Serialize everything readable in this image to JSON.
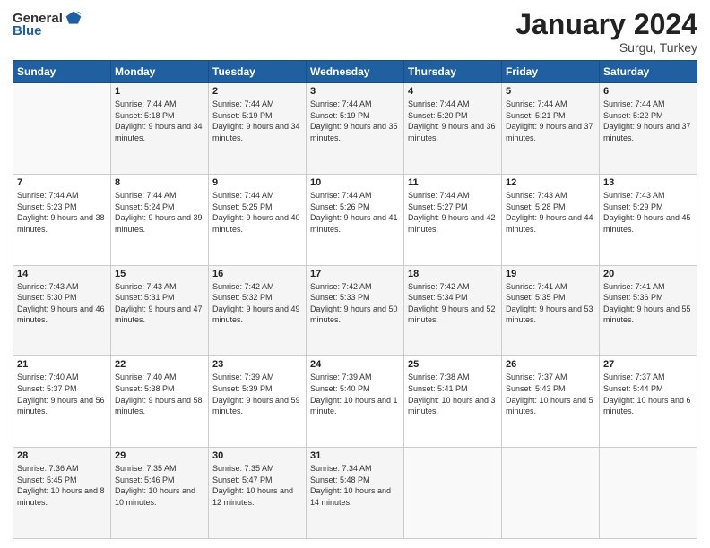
{
  "logo": {
    "general": "General",
    "blue": "Blue"
  },
  "title": "January 2024",
  "location": "Surgu, Turkey",
  "days_header": [
    "Sunday",
    "Monday",
    "Tuesday",
    "Wednesday",
    "Thursday",
    "Friday",
    "Saturday"
  ],
  "weeks": [
    [
      {
        "day": "",
        "sunrise": "",
        "sunset": "",
        "daylight": ""
      },
      {
        "day": "1",
        "sunrise": "Sunrise: 7:44 AM",
        "sunset": "Sunset: 5:18 PM",
        "daylight": "Daylight: 9 hours and 34 minutes."
      },
      {
        "day": "2",
        "sunrise": "Sunrise: 7:44 AM",
        "sunset": "Sunset: 5:19 PM",
        "daylight": "Daylight: 9 hours and 34 minutes."
      },
      {
        "day": "3",
        "sunrise": "Sunrise: 7:44 AM",
        "sunset": "Sunset: 5:19 PM",
        "daylight": "Daylight: 9 hours and 35 minutes."
      },
      {
        "day": "4",
        "sunrise": "Sunrise: 7:44 AM",
        "sunset": "Sunset: 5:20 PM",
        "daylight": "Daylight: 9 hours and 36 minutes."
      },
      {
        "day": "5",
        "sunrise": "Sunrise: 7:44 AM",
        "sunset": "Sunset: 5:21 PM",
        "daylight": "Daylight: 9 hours and 37 minutes."
      },
      {
        "day": "6",
        "sunrise": "Sunrise: 7:44 AM",
        "sunset": "Sunset: 5:22 PM",
        "daylight": "Daylight: 9 hours and 37 minutes."
      }
    ],
    [
      {
        "day": "7",
        "sunrise": "Sunrise: 7:44 AM",
        "sunset": "Sunset: 5:23 PM",
        "daylight": "Daylight: 9 hours and 38 minutes."
      },
      {
        "day": "8",
        "sunrise": "Sunrise: 7:44 AM",
        "sunset": "Sunset: 5:24 PM",
        "daylight": "Daylight: 9 hours and 39 minutes."
      },
      {
        "day": "9",
        "sunrise": "Sunrise: 7:44 AM",
        "sunset": "Sunset: 5:25 PM",
        "daylight": "Daylight: 9 hours and 40 minutes."
      },
      {
        "day": "10",
        "sunrise": "Sunrise: 7:44 AM",
        "sunset": "Sunset: 5:26 PM",
        "daylight": "Daylight: 9 hours and 41 minutes."
      },
      {
        "day": "11",
        "sunrise": "Sunrise: 7:44 AM",
        "sunset": "Sunset: 5:27 PM",
        "daylight": "Daylight: 9 hours and 42 minutes."
      },
      {
        "day": "12",
        "sunrise": "Sunrise: 7:43 AM",
        "sunset": "Sunset: 5:28 PM",
        "daylight": "Daylight: 9 hours and 44 minutes."
      },
      {
        "day": "13",
        "sunrise": "Sunrise: 7:43 AM",
        "sunset": "Sunset: 5:29 PM",
        "daylight": "Daylight: 9 hours and 45 minutes."
      }
    ],
    [
      {
        "day": "14",
        "sunrise": "Sunrise: 7:43 AM",
        "sunset": "Sunset: 5:30 PM",
        "daylight": "Daylight: 9 hours and 46 minutes."
      },
      {
        "day": "15",
        "sunrise": "Sunrise: 7:43 AM",
        "sunset": "Sunset: 5:31 PM",
        "daylight": "Daylight: 9 hours and 47 minutes."
      },
      {
        "day": "16",
        "sunrise": "Sunrise: 7:42 AM",
        "sunset": "Sunset: 5:32 PM",
        "daylight": "Daylight: 9 hours and 49 minutes."
      },
      {
        "day": "17",
        "sunrise": "Sunrise: 7:42 AM",
        "sunset": "Sunset: 5:33 PM",
        "daylight": "Daylight: 9 hours and 50 minutes."
      },
      {
        "day": "18",
        "sunrise": "Sunrise: 7:42 AM",
        "sunset": "Sunset: 5:34 PM",
        "daylight": "Daylight: 9 hours and 52 minutes."
      },
      {
        "day": "19",
        "sunrise": "Sunrise: 7:41 AM",
        "sunset": "Sunset: 5:35 PM",
        "daylight": "Daylight: 9 hours and 53 minutes."
      },
      {
        "day": "20",
        "sunrise": "Sunrise: 7:41 AM",
        "sunset": "Sunset: 5:36 PM",
        "daylight": "Daylight: 9 hours and 55 minutes."
      }
    ],
    [
      {
        "day": "21",
        "sunrise": "Sunrise: 7:40 AM",
        "sunset": "Sunset: 5:37 PM",
        "daylight": "Daylight: 9 hours and 56 minutes."
      },
      {
        "day": "22",
        "sunrise": "Sunrise: 7:40 AM",
        "sunset": "Sunset: 5:38 PM",
        "daylight": "Daylight: 9 hours and 58 minutes."
      },
      {
        "day": "23",
        "sunrise": "Sunrise: 7:39 AM",
        "sunset": "Sunset: 5:39 PM",
        "daylight": "Daylight: 9 hours and 59 minutes."
      },
      {
        "day": "24",
        "sunrise": "Sunrise: 7:39 AM",
        "sunset": "Sunset: 5:40 PM",
        "daylight": "Daylight: 10 hours and 1 minute."
      },
      {
        "day": "25",
        "sunrise": "Sunrise: 7:38 AM",
        "sunset": "Sunset: 5:41 PM",
        "daylight": "Daylight: 10 hours and 3 minutes."
      },
      {
        "day": "26",
        "sunrise": "Sunrise: 7:37 AM",
        "sunset": "Sunset: 5:43 PM",
        "daylight": "Daylight: 10 hours and 5 minutes."
      },
      {
        "day": "27",
        "sunrise": "Sunrise: 7:37 AM",
        "sunset": "Sunset: 5:44 PM",
        "daylight": "Daylight: 10 hours and 6 minutes."
      }
    ],
    [
      {
        "day": "28",
        "sunrise": "Sunrise: 7:36 AM",
        "sunset": "Sunset: 5:45 PM",
        "daylight": "Daylight: 10 hours and 8 minutes."
      },
      {
        "day": "29",
        "sunrise": "Sunrise: 7:35 AM",
        "sunset": "Sunset: 5:46 PM",
        "daylight": "Daylight: 10 hours and 10 minutes."
      },
      {
        "day": "30",
        "sunrise": "Sunrise: 7:35 AM",
        "sunset": "Sunset: 5:47 PM",
        "daylight": "Daylight: 10 hours and 12 minutes."
      },
      {
        "day": "31",
        "sunrise": "Sunrise: 7:34 AM",
        "sunset": "Sunset: 5:48 PM",
        "daylight": "Daylight: 10 hours and 14 minutes."
      },
      {
        "day": "",
        "sunrise": "",
        "sunset": "",
        "daylight": ""
      },
      {
        "day": "",
        "sunrise": "",
        "sunset": "",
        "daylight": ""
      },
      {
        "day": "",
        "sunrise": "",
        "sunset": "",
        "daylight": ""
      }
    ]
  ]
}
